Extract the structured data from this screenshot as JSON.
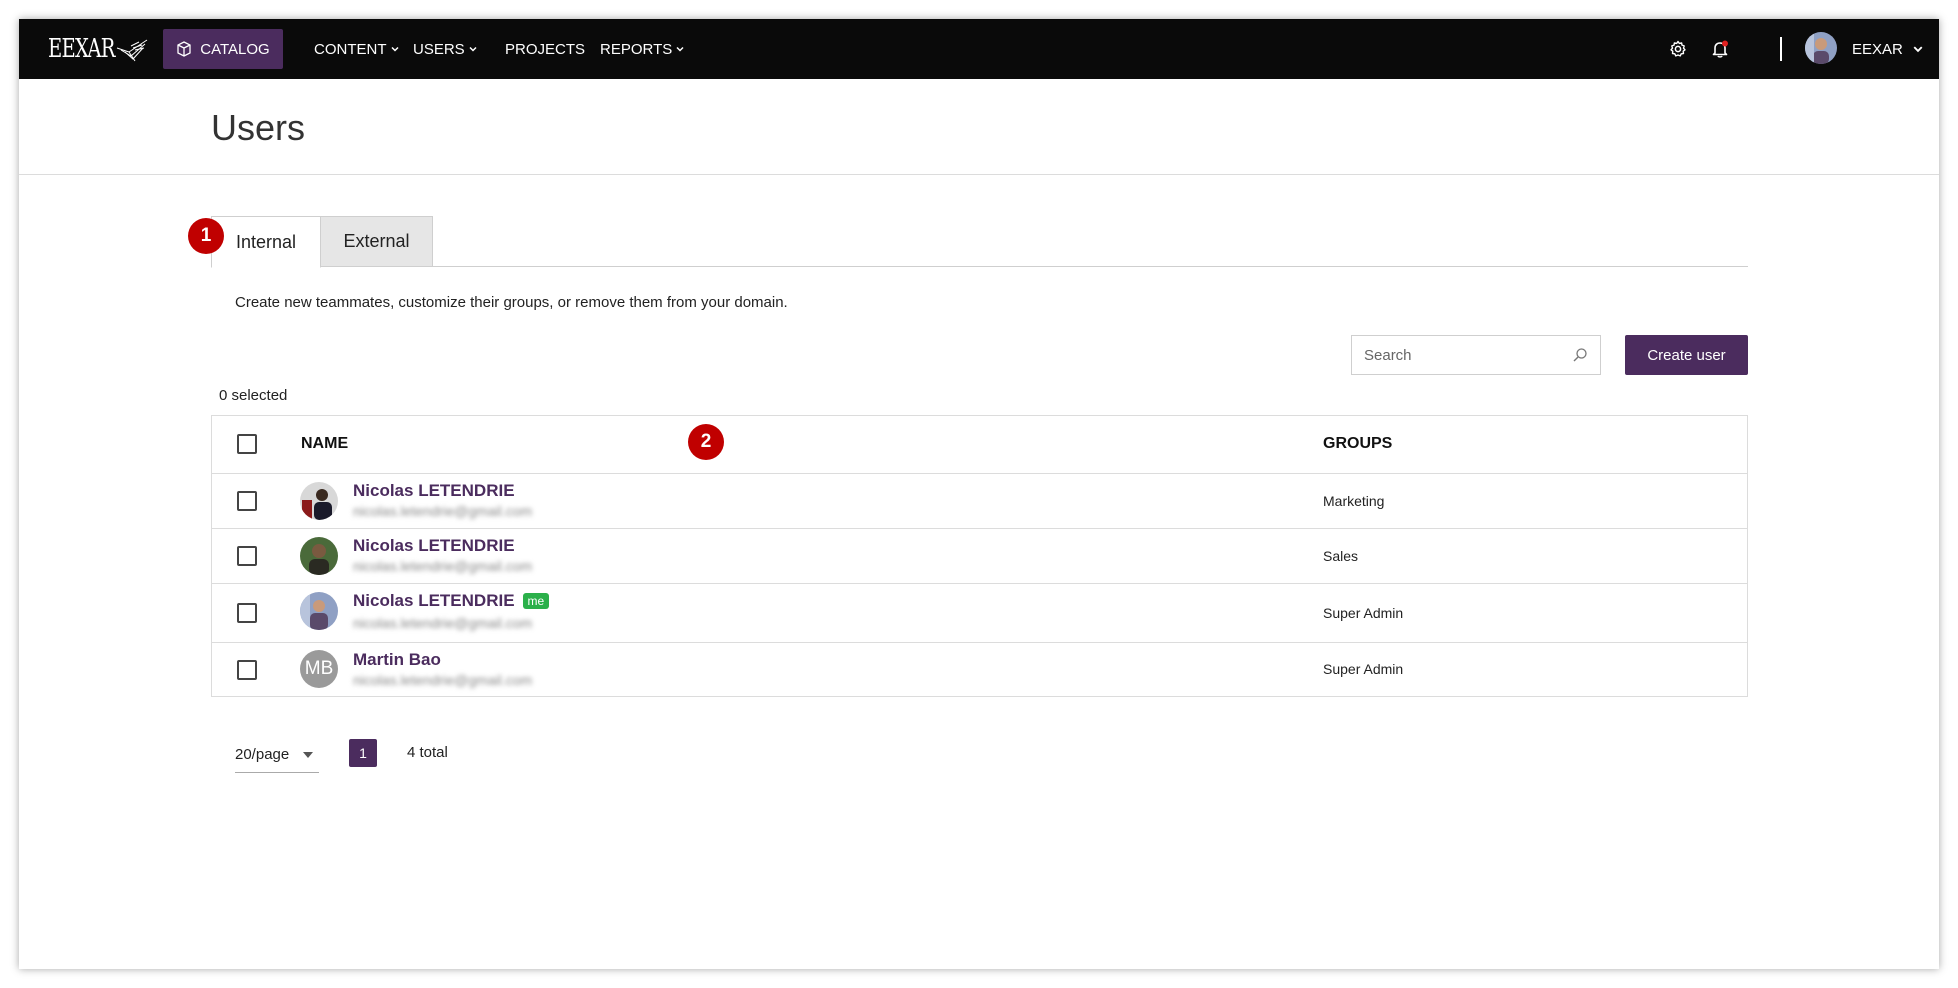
{
  "nav": {
    "logo": "EEXAR",
    "catalog_label": "CATALOG",
    "items": [
      {
        "label": "CONTENT",
        "has_dropdown": true
      },
      {
        "label": "USERS",
        "has_dropdown": true
      },
      {
        "label": "PROJECTS",
        "has_dropdown": false
      },
      {
        "label": "REPORTS",
        "has_dropdown": true
      }
    ],
    "user_name": "EEXAR"
  },
  "page": {
    "title": "Users"
  },
  "tabs": [
    {
      "label": "Internal",
      "active": true
    },
    {
      "label": "External",
      "active": false
    }
  ],
  "markers": [
    "1",
    "2"
  ],
  "description": "Create new teammates, customize their groups, or remove them from your domain.",
  "search": {
    "placeholder": "Search"
  },
  "create_button": "Create user",
  "selected_count": "0 selected",
  "table": {
    "headers": {
      "name": "NAME",
      "groups": "GROUPS"
    },
    "rows": [
      {
        "name": "Nicolas LETENDRIE",
        "email": "nicolas.letendrie@gmail.com",
        "group": "Marketing",
        "me": false
      },
      {
        "name": "Nicolas LETENDRIE",
        "email": "nicolas.letendrie@gmail.com",
        "group": "Sales",
        "me": false
      },
      {
        "name": "Nicolas LETENDRIE",
        "email": "nicolas.letendrie@gmail.com",
        "group": "Super Admin",
        "me": true,
        "me_label": "me"
      },
      {
        "name": "Martin Bao",
        "email": "nicolas.letendrie@gmail.com",
        "group": "Super Admin",
        "me": false,
        "initials": "MB"
      }
    ]
  },
  "pagination": {
    "per_page": "20/page",
    "current_page": "1",
    "total": "4 total"
  },
  "colors": {
    "accent": "#4b2c5e",
    "nav_bg": "#0a0a0a",
    "marker": "#c00000",
    "me_badge": "#2bb04a"
  }
}
